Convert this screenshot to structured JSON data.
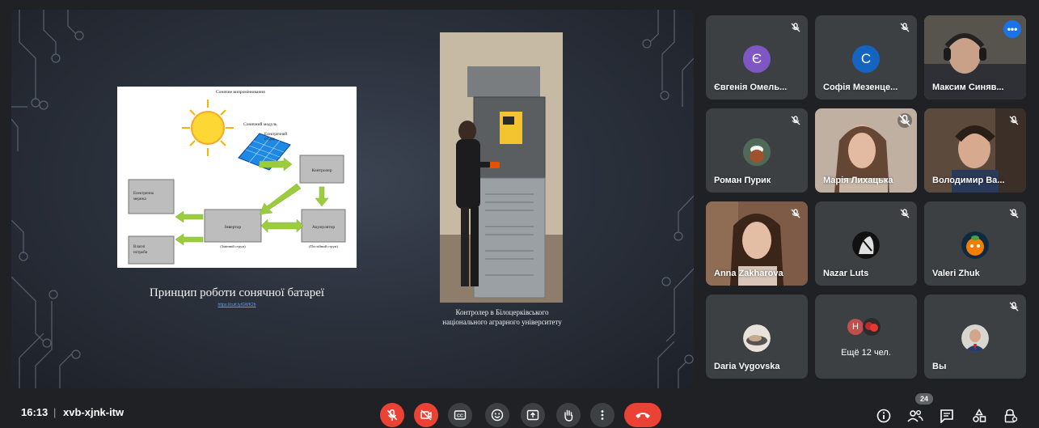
{
  "slide": {
    "diagram": {
      "title": "Сонячне випромінювання",
      "module": "Сонячний модуль",
      "current": "Електричний\nструм",
      "controller": "Контролер",
      "grid": "Електрична\nмережа",
      "inverter": "Інвертор",
      "accumulator": "Акумулятор",
      "own_needs": "Власні\nпотреби",
      "ac": "(Змінний струм)",
      "dc": "(Постійний струм)"
    },
    "caption": "Принцип роботи сонячної батареї",
    "caption_link": "https://cutt.ly/GWK2h",
    "photo_caption_line1": "Контролер в Білоцерківського",
    "photo_caption_line2": "національного аграрного університету"
  },
  "participants": [
    {
      "name": "Євгенія Омель...",
      "initial": "Є",
      "avatar_color": "#7e57c2",
      "type": "avatar"
    },
    {
      "name": "Софія Мезенце...",
      "initial": "С",
      "avatar_color": "#1565c0",
      "type": "avatar"
    },
    {
      "name": "Максим Синяв...",
      "type": "video",
      "active": true
    },
    {
      "name": "Роман Пурик",
      "type": "photo"
    },
    {
      "name": "Марія Лихацька",
      "type": "video"
    },
    {
      "name": "Володимир Ва...",
      "type": "video"
    },
    {
      "name": "Anna Zakharova",
      "type": "video"
    },
    {
      "name": "Nazar Luts",
      "type": "photo"
    },
    {
      "name": "Valeri Zhuk",
      "type": "photo"
    },
    {
      "name": "Daria Vygovska",
      "type": "photo"
    },
    {
      "name": "Ещё 12 чел.",
      "initial": "Н",
      "type": "more"
    },
    {
      "name": "Вы",
      "type": "photo"
    }
  ],
  "bar": {
    "time": "16:13",
    "separator": "|",
    "meeting_code": "xvb-xjnk-itw",
    "people_count": "24"
  },
  "colors": {
    "background": "#202124",
    "tile": "#3c4043",
    "danger": "#ea4335",
    "accent": "#8ab4f8"
  }
}
